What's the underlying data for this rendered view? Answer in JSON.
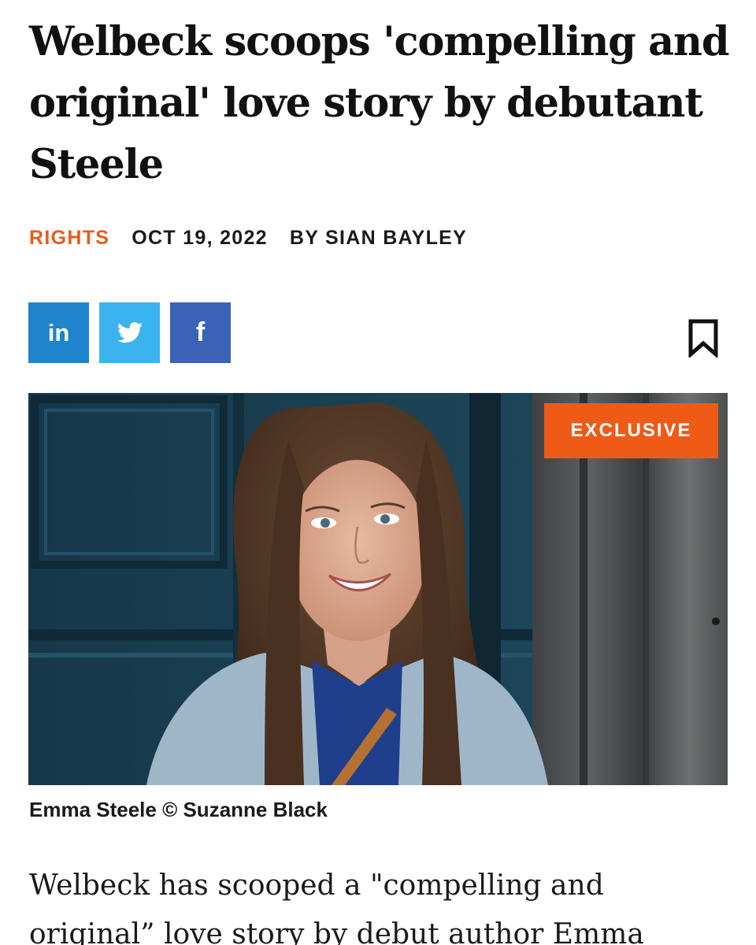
{
  "article": {
    "headline": "Welbeck scoops 'compelling and original' love story by debutant Steele",
    "category": "RIGHTS",
    "date": "OCT 19, 2022",
    "byline": "BY SIAN BAYLEY",
    "badge": "EXCLUSIVE",
    "caption": "Emma Steele © Suzanne Black",
    "body_intro": "Welbeck has scooped a \"compelling and original” love story by debut author Emma"
  },
  "share": {
    "linkedin_label": "in",
    "facebook_label": "f",
    "icons": [
      "linkedin-icon",
      "twitter-icon",
      "facebook-icon",
      "bookmark-icon"
    ]
  },
  "colors": {
    "accent": "#ea5a1c",
    "linkedin": "#1f84cc",
    "twitter": "#3ab3ee",
    "facebook": "#3a63b8",
    "badge": "#ef5a16"
  }
}
